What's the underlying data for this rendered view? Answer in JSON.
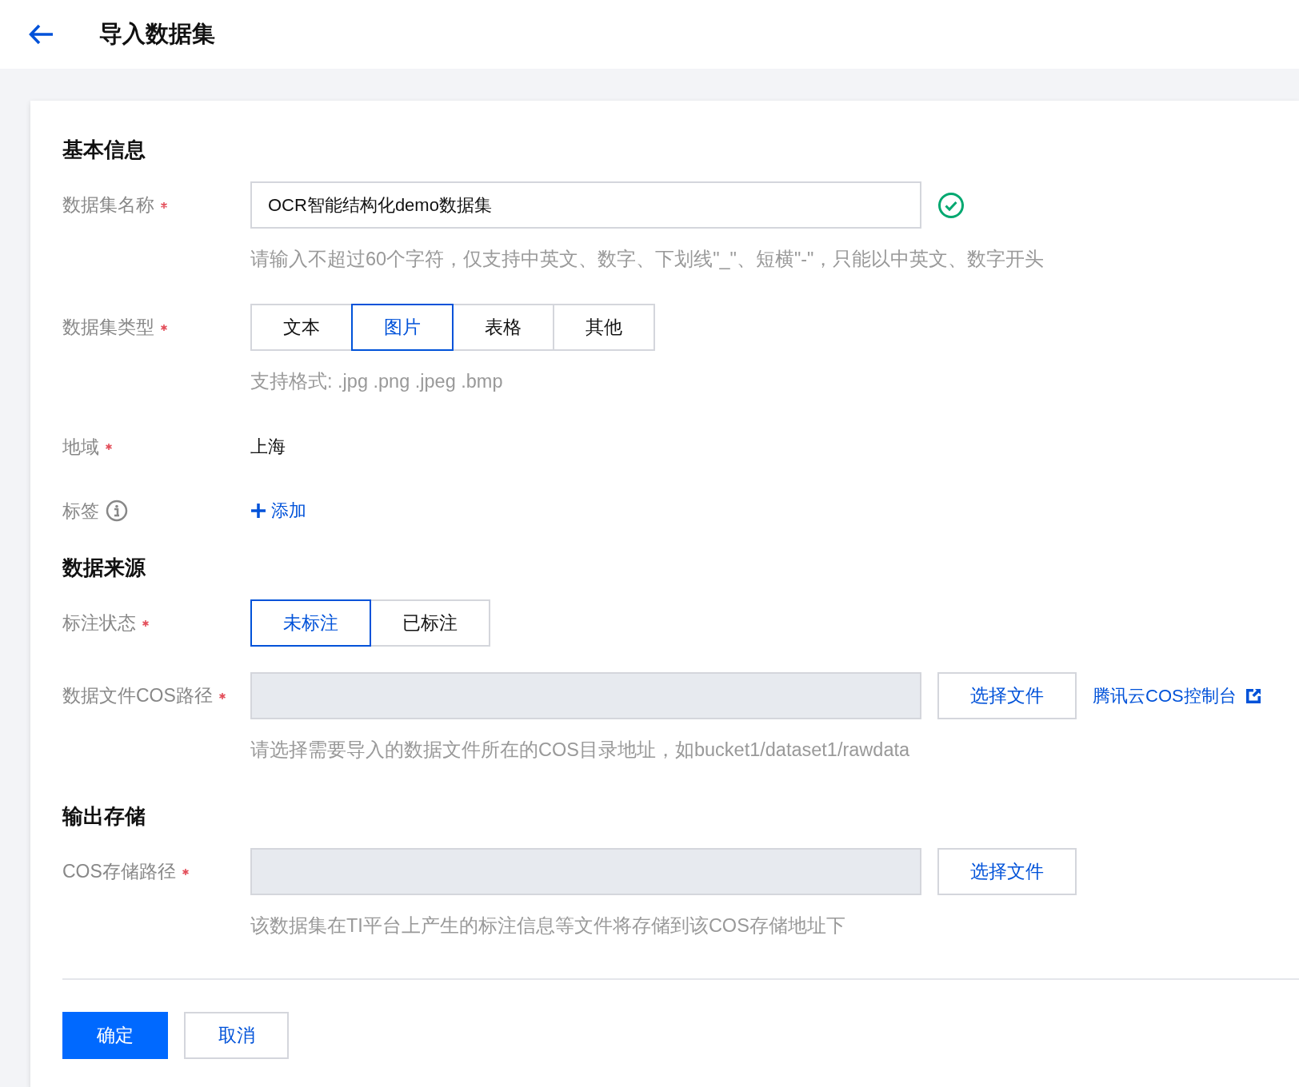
{
  "header": {
    "title": "导入数据集"
  },
  "sections": [
    {
      "title": "基本信息",
      "fields": [
        {
          "kind": "text_input",
          "label": "数据集名称",
          "required": true,
          "value": "OCR智能结构化demo数据集",
          "valid": true,
          "hint": "请输入不超过60个字符，仅支持中英文、数字、下划线\"_\"、短横\"-\"，只能以中英文、数字开头"
        },
        {
          "kind": "segmented",
          "label": "数据集类型",
          "required": true,
          "options": [
            {
              "label": "文本",
              "selected": false
            },
            {
              "label": "图片",
              "selected": true
            },
            {
              "label": "表格",
              "selected": false
            },
            {
              "label": "其他",
              "selected": false
            }
          ],
          "hint": "支持格式: .jpg .png .jpeg .bmp"
        },
        {
          "kind": "static",
          "label": "地域",
          "required": true,
          "value": "上海"
        },
        {
          "kind": "tag_add",
          "label": "标签",
          "required": false,
          "info": true,
          "action": "添加"
        }
      ]
    },
    {
      "title": "数据来源",
      "fields": [
        {
          "kind": "segmented",
          "label": "标注状态",
          "required": true,
          "options": [
            {
              "label": "未标注",
              "selected": true
            },
            {
              "label": "已标注",
              "selected": false
            }
          ]
        },
        {
          "kind": "path_input",
          "label": "数据文件COS路径",
          "required": true,
          "button": "选择文件",
          "link": "腾讯云COS控制台",
          "hint": "请选择需要导入的数据文件所在的COS目录地址，如bucket1/dataset1/rawdata"
        }
      ]
    },
    {
      "title": "输出存储",
      "fields": [
        {
          "kind": "path_input",
          "label": "COS存储路径",
          "required": true,
          "button": "选择文件",
          "hint": "该数据集在TI平台上产生的标注信息等文件将存储到该COS存储地址下"
        }
      ]
    }
  ],
  "footer": {
    "buttons": [
      {
        "label": "确定",
        "primary": true
      },
      {
        "label": "取消",
        "primary": false
      }
    ]
  }
}
